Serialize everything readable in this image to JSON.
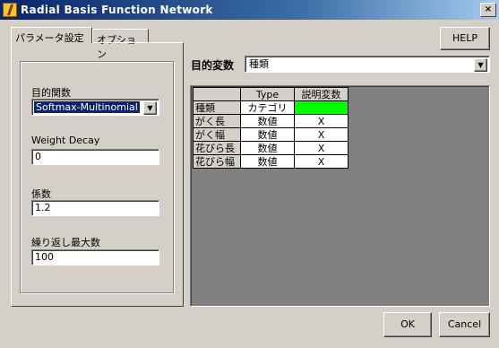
{
  "window": {
    "title": "Radial Basis Function Network",
    "close_glyph": "×"
  },
  "tabs": [
    {
      "label": "パラメータ設定",
      "active": true
    },
    {
      "label": "オプション",
      "active": false
    }
  ],
  "params": {
    "objective_label": "目的関数",
    "objective_value": "Softmax-Multinomial",
    "weight_decay_label": "Weight Decay",
    "weight_decay_value": "0",
    "coefficient_label": "係数",
    "coefficient_value": "1.2",
    "max_iter_label": "繰り返し最大数",
    "max_iter_value": "100"
  },
  "target": {
    "label": "目的変数",
    "value": "種類"
  },
  "grid": {
    "headers": [
      "",
      "Type",
      "説明変数"
    ],
    "rows": [
      {
        "name": "種類",
        "type": "カテゴリ",
        "explanatory": ""
      },
      {
        "name": "がく長",
        "type": "数値",
        "explanatory": "X"
      },
      {
        "name": "がく幅",
        "type": "数値",
        "explanatory": "X"
      },
      {
        "name": "花びら長",
        "type": "数値",
        "explanatory": "X"
      },
      {
        "name": "花びら幅",
        "type": "数値",
        "explanatory": "X"
      }
    ],
    "highlight_color": "#00ff00"
  },
  "buttons": {
    "help": "HELP",
    "ok": "OK",
    "cancel": "Cancel"
  },
  "icons": {
    "app": "app-icon",
    "dropdown": "▼"
  },
  "colors": {
    "titlebar_start": "#0a246a",
    "titlebar_end": "#a6caf0",
    "dialog_bg": "#d4d0c8",
    "grid_bg": "#808080"
  }
}
